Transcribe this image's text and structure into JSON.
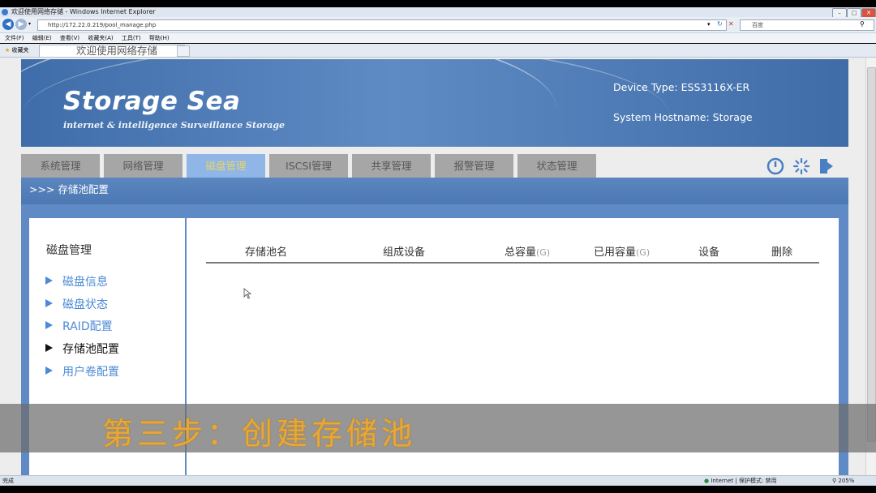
{
  "window": {
    "title": "欢迎使用网络存储 - Windows Internet Explorer",
    "url": "http://172.22.0.219/pool_manage.php",
    "search_placeholder": "百度",
    "menu": [
      "文件(F)",
      "编辑(E)",
      "查看(V)",
      "收藏夹(A)",
      "工具(T)",
      "帮助(H)"
    ],
    "favorites_label": "收藏夹",
    "tab_title": "欢迎使用网络存储",
    "status_text": "完成",
    "status_zone": "Internet | 保护模式: 禁用",
    "zoom": "205%"
  },
  "header": {
    "brand": "Storage Sea",
    "tagline": "internet & intelligence Surveillance Storage",
    "device_type": "Device Type: ESS3116X-ER",
    "hostname": "System Hostname: Storage"
  },
  "tabs": [
    {
      "label": "系统管理",
      "active": false
    },
    {
      "label": "网络管理",
      "active": false
    },
    {
      "label": "磁盘管理",
      "active": true
    },
    {
      "label": "ISCSI管理",
      "active": false
    },
    {
      "label": "共享管理",
      "active": false
    },
    {
      "label": "报警管理",
      "active": false
    },
    {
      "label": "状态管理",
      "active": false
    }
  ],
  "breadcrumb": ">>> 存储池配置",
  "sidebar": {
    "title": "磁盘管理",
    "items": [
      {
        "label": "磁盘信息",
        "current": false
      },
      {
        "label": "磁盘状态",
        "current": false
      },
      {
        "label": "RAID配置",
        "current": false
      },
      {
        "label": "存储池配置",
        "current": true
      },
      {
        "label": "用户卷配置",
        "current": false
      }
    ]
  },
  "table": {
    "columns": [
      {
        "label": "存储池名",
        "unit": ""
      },
      {
        "label": "组成设备",
        "unit": ""
      },
      {
        "label": "总容量",
        "unit": "(G)"
      },
      {
        "label": "已用容量",
        "unit": "(G)"
      },
      {
        "label": "设备",
        "unit": ""
      },
      {
        "label": "删除",
        "unit": ""
      }
    ]
  },
  "subtitle": "第三步：创建存储池",
  "colors": {
    "accent_blue": "#5f8ac5",
    "active_tab": "#8fb6e6",
    "subtitle": "#e8a833"
  }
}
